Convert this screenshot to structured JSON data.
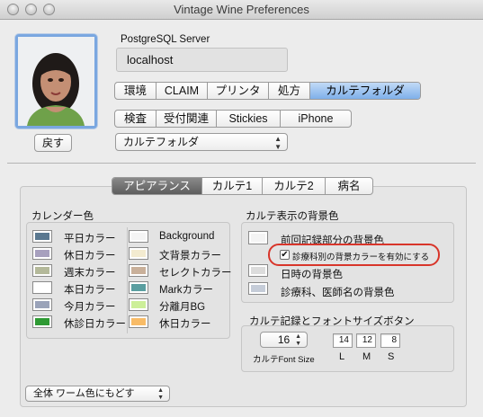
{
  "window": {
    "title": "Vintage Wine Preferences"
  },
  "photo": {
    "back_button": "戻す"
  },
  "server": {
    "label": "PostgreSQL Server",
    "value": "localhost"
  },
  "top_tabs_row1": [
    "環境",
    "CLAIM",
    "プリンタ",
    "処方",
    "カルテフォルダ"
  ],
  "top_tabs_row2": [
    "検査",
    "受付関連",
    "Stickies",
    "iPhone"
  ],
  "folder_popup": {
    "value": "カルテフォルダ"
  },
  "sub_tabs": [
    "アピアランス",
    "カルテ1",
    "カルテ2",
    "病名"
  ],
  "calendar": {
    "title": "カレンダー色",
    "left": [
      {
        "label": "平日カラー",
        "color": "#5a7890"
      },
      {
        "label": "休日カラー",
        "color": "#a7a0be"
      },
      {
        "label": "週末カラー",
        "color": "#b4b99a"
      },
      {
        "label": "本日カラー",
        "color": "#ffffff"
      },
      {
        "label": "今月カラー",
        "color": "#9aa3b9"
      },
      {
        "label": "休診日カラー",
        "color": "#2e9a33"
      }
    ],
    "right": [
      {
        "label": "Background",
        "color": "#f4f4f4"
      },
      {
        "label": "文背景カラー",
        "color": "#f3ebd0"
      },
      {
        "label": "セレクトカラー",
        "color": "#c9b09a"
      },
      {
        "label": "Markカラー",
        "color": "#5a9ea0"
      },
      {
        "label": "分離月BG",
        "color": "#ccef98"
      },
      {
        "label": "休日カラー",
        "color": "#f8bb66"
      }
    ]
  },
  "chart_bg": {
    "title": "カルテ表示の背景色",
    "prev_label": "前回記録部分の背景色",
    "checkbox_label": "診療科別の背景カラーを有効にする",
    "checkbox_checked": true,
    "date_label": "日時の背景色",
    "dept_label": "診療科、医師名の背景色",
    "highlight_color": "#d8352a"
  },
  "font_size": {
    "title": "カルテ記録とフォントサイズボタン",
    "stepper_value": "16",
    "stepper_label": "カルテFont Size",
    "l_value": "14",
    "m_value": "12",
    "s_value": "8",
    "l_label": "L",
    "m_label": "M",
    "s_label": "S"
  },
  "reset_popup": {
    "value": "全体 ワーム色にもどす"
  }
}
